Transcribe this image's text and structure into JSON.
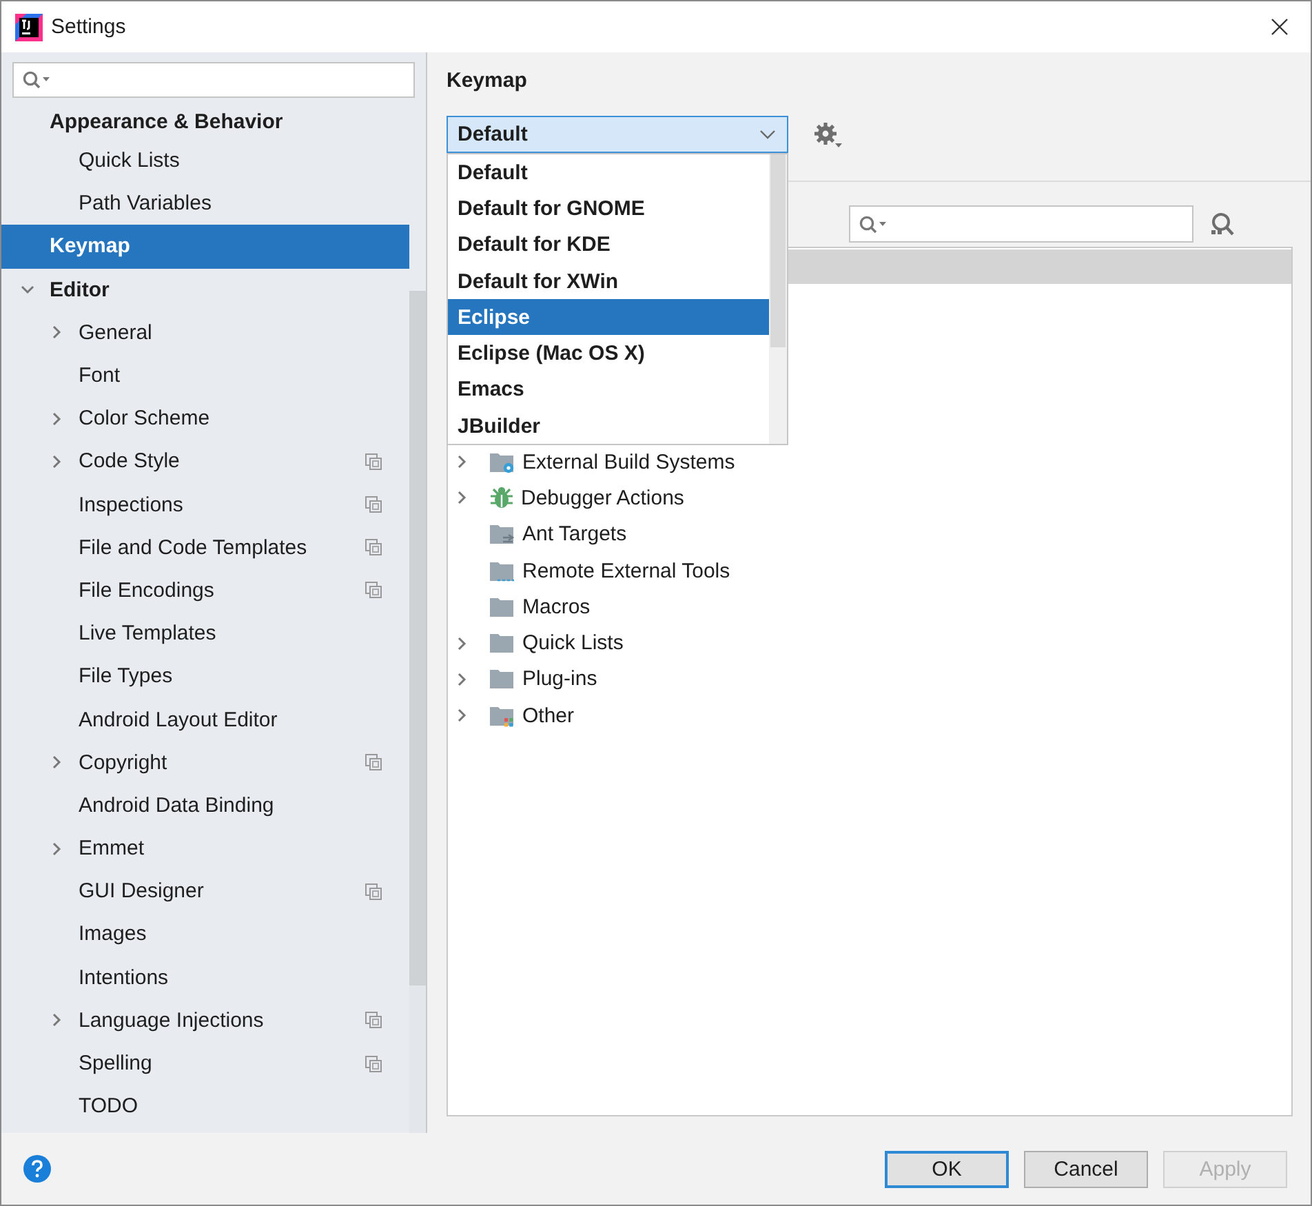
{
  "window": {
    "title": "Settings"
  },
  "sidebar": {
    "items": [
      {
        "label": "Appearance & Behavior",
        "selected": false,
        "children": [
          {
            "label": "Quick Lists",
            "selected": false
          },
          {
            "label": "Path Variables",
            "selected": false
          }
        ]
      },
      {
        "label": "Keymap",
        "selected": true
      },
      {
        "label": "Editor",
        "selected": false,
        "expanded": true,
        "children": [
          {
            "label": "General",
            "selected": false,
            "project_scope": false,
            "expanded": false
          },
          {
            "label": "Font",
            "selected": false,
            "project_scope": false
          },
          {
            "label": "Color Scheme",
            "selected": false,
            "project_scope": false,
            "expanded": false
          },
          {
            "label": "Code Style",
            "selected": false,
            "project_scope": true,
            "expanded": false
          },
          {
            "label": "Inspections",
            "selected": false,
            "project_scope": true
          },
          {
            "label": "File and Code Templates",
            "selected": false,
            "project_scope": true
          },
          {
            "label": "File Encodings",
            "selected": false,
            "project_scope": true
          },
          {
            "label": "Live Templates",
            "selected": false,
            "project_scope": false
          },
          {
            "label": "File Types",
            "selected": false,
            "project_scope": false
          },
          {
            "label": "Android Layout Editor",
            "selected": false,
            "project_scope": false
          },
          {
            "label": "Copyright",
            "selected": false,
            "project_scope": true,
            "expanded": false
          },
          {
            "label": "Android Data Binding",
            "selected": false,
            "project_scope": false
          },
          {
            "label": "Emmet",
            "selected": false,
            "project_scope": false,
            "expanded": false
          },
          {
            "label": "GUI Designer",
            "selected": false,
            "project_scope": true
          },
          {
            "label": "Images",
            "selected": false,
            "project_scope": false
          },
          {
            "label": "Intentions",
            "selected": false,
            "project_scope": false
          },
          {
            "label": "Language Injections",
            "selected": false,
            "project_scope": true,
            "expanded": false
          },
          {
            "label": "Spelling",
            "selected": false,
            "project_scope": true
          },
          {
            "label": "TODO",
            "selected": false,
            "project_scope": false
          }
        ]
      }
    ]
  },
  "keymap": {
    "title": "Keymap",
    "select": {
      "value": "Default",
      "options": [
        {
          "label": "Default",
          "highlighted": false
        },
        {
          "label": "Default for GNOME",
          "highlighted": false
        },
        {
          "label": "Default for KDE",
          "highlighted": false
        },
        {
          "label": "Default for XWin",
          "highlighted": false
        },
        {
          "label": "Eclipse",
          "highlighted": true
        },
        {
          "label": "Eclipse (Mac OS X)",
          "highlighted": false
        },
        {
          "label": "Emacs",
          "highlighted": false
        },
        {
          "label": "JBuilder",
          "highlighted": false
        }
      ]
    },
    "tree": [
      {
        "label": "External Build Systems",
        "kind": "folder-gear",
        "expanded": false
      },
      {
        "label": "Debugger Actions",
        "kind": "bug",
        "expanded": false
      },
      {
        "label": "Ant Targets",
        "kind": "folder-arrow"
      },
      {
        "label": "Remote External Tools",
        "kind": "folder-dots"
      },
      {
        "label": "Macros",
        "kind": "folder"
      },
      {
        "label": "Quick Lists",
        "kind": "folder",
        "expanded": false
      },
      {
        "label": "Plug-ins",
        "kind": "folder",
        "expanded": false
      },
      {
        "label": "Other",
        "kind": "folder-colors",
        "expanded": false
      }
    ]
  },
  "buttons": [
    {
      "label": "OK",
      "default": true,
      "disabled": false
    },
    {
      "label": "Cancel",
      "default": false,
      "disabled": false
    },
    {
      "label": "Apply",
      "default": false,
      "disabled": true
    }
  ]
}
